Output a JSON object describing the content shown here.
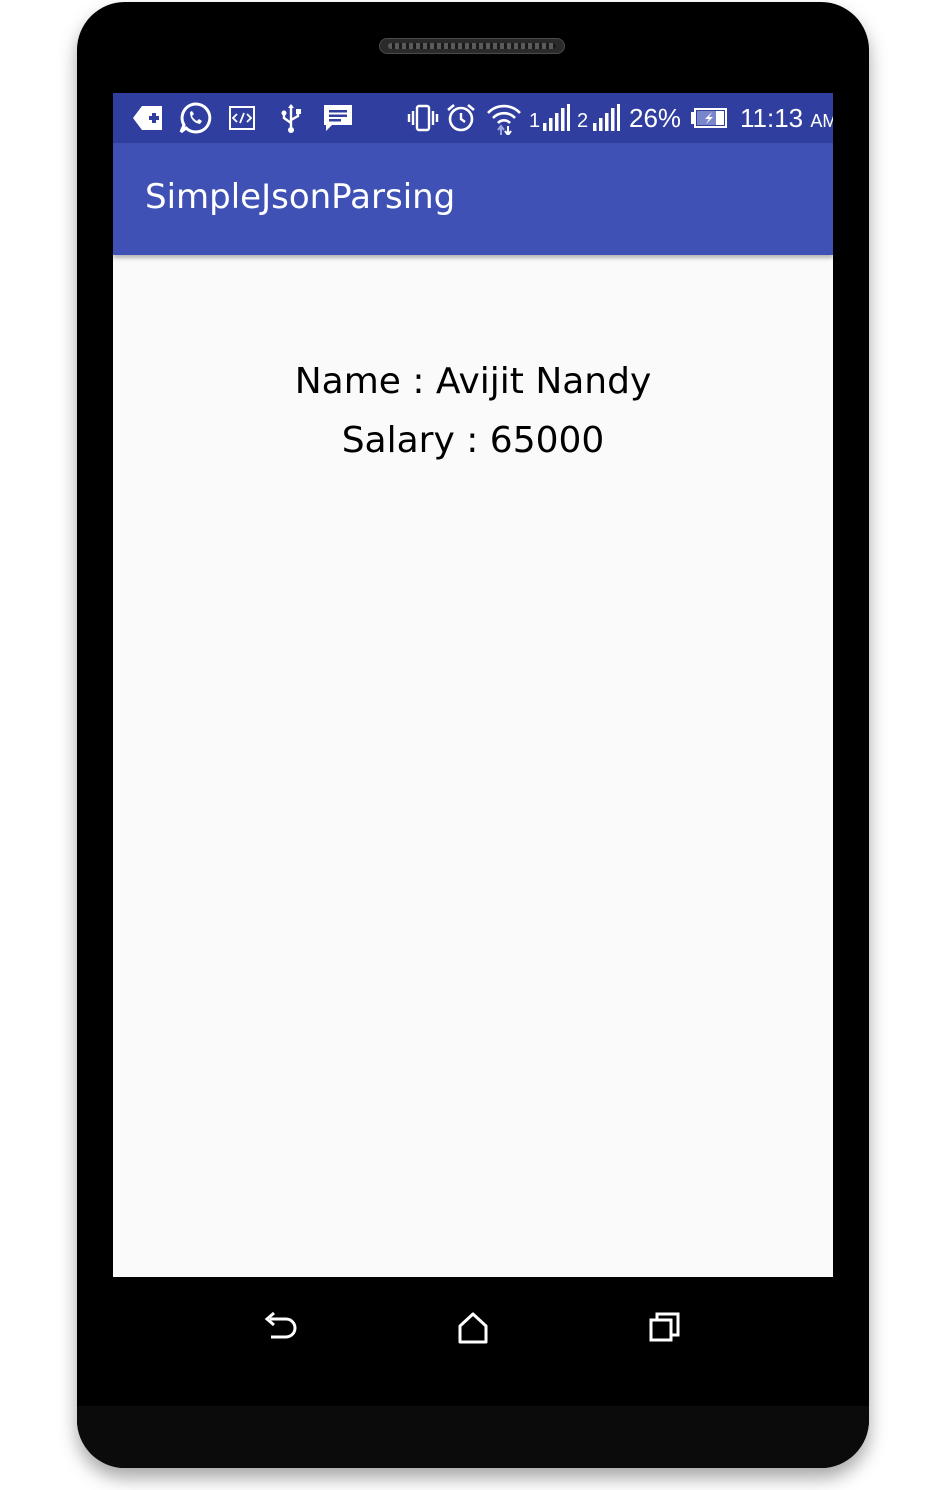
{
  "status_bar": {
    "battery_percent": "26%",
    "time": "11:13",
    "ampm": "AM",
    "sim1_label": "1",
    "sim2_label": "2",
    "icons_left": [
      "add-contact-icon",
      "whatsapp-icon",
      "code-icon",
      "usb-icon",
      "message-icon"
    ],
    "icons_right": [
      "vibrate-icon",
      "alarm-icon",
      "wifi-icon",
      "signal-sim1-icon",
      "signal-sim2-icon",
      "battery-charging-icon"
    ],
    "background": "#303f9f"
  },
  "app_bar": {
    "title": "SimpleJsonParsing",
    "background": "#3f51b5"
  },
  "content": {
    "name_line": "Name : Avijit Nandy",
    "salary_line": "Salary : 65000"
  },
  "nav_bar": {
    "buttons": [
      "back-icon",
      "home-icon",
      "recents-icon"
    ]
  }
}
